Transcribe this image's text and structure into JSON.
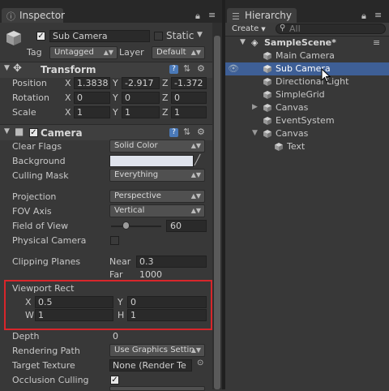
{
  "inspector": {
    "tab_title": "Inspector",
    "object_name": "Sub Camera",
    "static_label": "Static",
    "tag_label": "Tag",
    "tag_value": "Untagged",
    "layer_label": "Layer",
    "layer_value": "Default",
    "transform": {
      "title": "Transform",
      "position_label": "Position",
      "rotation_label": "Rotation",
      "scale_label": "Scale",
      "x": "X",
      "y": "Y",
      "z": "Z",
      "position": [
        "1.3838",
        "-2.917",
        "-1.372"
      ],
      "rotation": [
        "0",
        "0",
        "0"
      ],
      "scale": [
        "1",
        "1",
        "1"
      ]
    },
    "camera": {
      "title": "Camera",
      "clear_flags_label": "Clear Flags",
      "clear_flags_value": "Solid Color",
      "background_label": "Background",
      "background_color": "#dfe3ec",
      "culling_mask_label": "Culling Mask",
      "culling_mask_value": "Everything",
      "projection_label": "Projection",
      "projection_value": "Perspective",
      "fov_axis_label": "FOV Axis",
      "fov_axis_value": "Vertical",
      "fov_label": "Field of View",
      "fov_value": "60",
      "physical_label": "Physical Camera",
      "clipping_label": "Clipping Planes",
      "near_label": "Near",
      "near_value": "0.3",
      "far_label": "Far",
      "far_value": "1000",
      "viewport_label": "Viewport Rect",
      "vp_x_label": "X",
      "vp_x": "0.5",
      "vp_y_label": "Y",
      "vp_y": "0",
      "vp_w_label": "W",
      "vp_w": "1",
      "vp_h_label": "H",
      "vp_h": "1",
      "depth_label": "Depth",
      "depth_value": "0",
      "rendering_path_label": "Rendering Path",
      "rendering_path_value": "Use Graphics Settin",
      "target_texture_label": "Target Texture",
      "target_texture_value": "None (Render Te",
      "occlusion_label": "Occlusion Culling"
    }
  },
  "hierarchy": {
    "tab_title": "Hierarchy",
    "create_label": "Create",
    "search_placeholder": "All",
    "scene_name": "SampleScene*",
    "items": [
      {
        "label": "Main Camera"
      },
      {
        "label": "Sub Camera"
      },
      {
        "label": "Directional Light"
      },
      {
        "label": "SimpleGrid"
      },
      {
        "label": "Canvas"
      },
      {
        "label": "EventSystem"
      },
      {
        "label": "Canvas"
      },
      {
        "label": "Text"
      }
    ]
  },
  "colors": {
    "selection": "#3e5f96",
    "highlight_box": "#d8262b"
  }
}
